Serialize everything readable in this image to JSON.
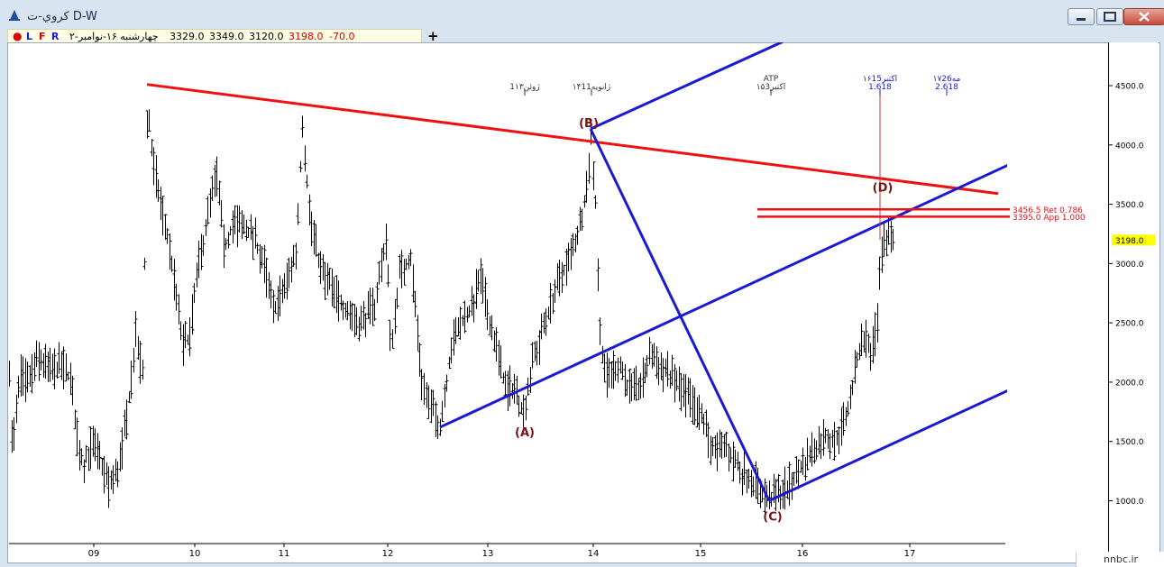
{
  "window": {
    "title": "كروي-ت D-W"
  },
  "toolbar": {
    "buttons": [
      "L",
      "F",
      "R"
    ],
    "date": "چهارشنبه ۱۶-نوامبر-۲",
    "open": "3329.0",
    "high": "3349.0",
    "low": "3120.0",
    "close": "3198.0",
    "change": "-70.0"
  },
  "colors": {
    "red_line": "#ee1111",
    "blue_line": "#1a1ad2",
    "wave_label": "#7a1010",
    "price_badge": "#ffff00"
  },
  "watermark": "nnbc.ir",
  "chart_data": {
    "type": "bar",
    "y_scale": "linear",
    "ylim": [
      700,
      4850
    ],
    "y_ticks": [
      1000,
      1500,
      2000,
      2500,
      3000,
      3500,
      4000,
      4500
    ],
    "y_tick_labels": [
      "1000.0",
      "1500.0",
      "2000.0",
      "2500.0",
      "3000.0",
      "3500.0",
      "4000.0",
      "4500.0"
    ],
    "xlim": [
      0,
      1105
    ],
    "x_ticks": [
      {
        "x": 94,
        "label": "09"
      },
      {
        "x": 206,
        "label": "10"
      },
      {
        "x": 305,
        "label": "11"
      },
      {
        "x": 420,
        "label": "12"
      },
      {
        "x": 531,
        "label": "13"
      },
      {
        "x": 648,
        "label": "14"
      },
      {
        "x": 767,
        "label": "15"
      },
      {
        "x": 880,
        "label": "16"
      },
      {
        "x": 999,
        "label": "17"
      }
    ],
    "last_price_label": "3198.0",
    "last_price": 3198,
    "time_markers": [
      {
        "x": 572,
        "label": "1ژوئن۱۳",
        "color": "#333"
      },
      {
        "x": 646,
        "label": "۱۴ژانویه11",
        "color": "#333"
      },
      {
        "x": 845,
        "label": "۱۵اکتبر3",
        "label_top": "ATP",
        "color": "#333"
      },
      {
        "x": 966,
        "label": "1.618",
        "label_top": "۱۶اکتبر15",
        "color": "#1a1ad2"
      },
      {
        "x": 1040,
        "label": "2.618",
        "label_top": "۱۷مه26",
        "color": "#1a1ad2"
      }
    ],
    "levels": [
      {
        "label": "3456.5 Ret 0.786",
        "value": 3456.5
      },
      {
        "label": "3395.0 App 1.000",
        "value": 3395.0
      }
    ],
    "wave_labels": [
      {
        "label": "(A)",
        "x": 572,
        "y": 1580
      },
      {
        "label": "(B)",
        "x": 643,
        "y": 4190
      },
      {
        "label": "(C)",
        "x": 847,
        "y": 870
      },
      {
        "label": "(D)",
        "x": 969,
        "y": 3645
      }
    ],
    "trendlines": [
      {
        "name": "upper-resistance",
        "color": "#ee1111",
        "x1": 153,
        "y1": 4510,
        "x2": 1097,
        "y2": 3590
      },
      {
        "name": "abc-b-to-c",
        "color": "#1a1ad2",
        "x1": 645,
        "y1": 4135,
        "x2": 843,
        "y2": 1000
      },
      {
        "name": "channel-mid",
        "color": "#1a1ad2",
        "x1": 478,
        "y1": 1620,
        "x2": 1108,
        "y2": 3830
      },
      {
        "name": "channel-top",
        "color": "#1a1ad2",
        "x1": 645,
        "y1": 4135,
        "x2": 858,
        "y2": 4870
      },
      {
        "name": "channel-bottom",
        "color": "#1a1ad2",
        "x1": 843,
        "y1": 1000,
        "x2": 1108,
        "y2": 1930
      },
      {
        "name": "target-vertical",
        "color": "#cc3333",
        "x1": 966,
        "y1": 3200,
        "x2": 966,
        "y2": 4450
      }
    ],
    "anchors": [
      {
        "x": 0,
        "v": 2150
      },
      {
        "x": 3,
        "v": 1400
      },
      {
        "x": 12,
        "v": 2050
      },
      {
        "x": 20,
        "v": 2000
      },
      {
        "x": 32,
        "v": 2200
      },
      {
        "x": 45,
        "v": 2100
      },
      {
        "x": 58,
        "v": 2150
      },
      {
        "x": 68,
        "v": 2000
      },
      {
        "x": 76,
        "v": 1500
      },
      {
        "x": 82,
        "v": 1300
      },
      {
        "x": 92,
        "v": 1480
      },
      {
        "x": 100,
        "v": 1350
      },
      {
        "x": 110,
        "v": 1130
      },
      {
        "x": 118,
        "v": 1200
      },
      {
        "x": 124,
        "v": 1400
      },
      {
        "x": 130,
        "v": 1700
      },
      {
        "x": 140,
        "v": 2400
      },
      {
        "x": 148,
        "v": 2050
      },
      {
        "x": 153,
        "v": 4400
      },
      {
        "x": 158,
        "v": 3900
      },
      {
        "x": 168,
        "v": 3500
      },
      {
        "x": 180,
        "v": 3000
      },
      {
        "x": 192,
        "v": 2300
      },
      {
        "x": 200,
        "v": 2400
      },
      {
        "x": 210,
        "v": 3000
      },
      {
        "x": 220,
        "v": 3400
      },
      {
        "x": 230,
        "v": 3750
      },
      {
        "x": 238,
        "v": 3100
      },
      {
        "x": 248,
        "v": 3350
      },
      {
        "x": 260,
        "v": 3300
      },
      {
        "x": 272,
        "v": 3200
      },
      {
        "x": 282,
        "v": 3000
      },
      {
        "x": 292,
        "v": 2600
      },
      {
        "x": 305,
        "v": 2800
      },
      {
        "x": 318,
        "v": 3100
      },
      {
        "x": 325,
        "v": 4200
      },
      {
        "x": 333,
        "v": 3400
      },
      {
        "x": 345,
        "v": 2950
      },
      {
        "x": 360,
        "v": 2750
      },
      {
        "x": 375,
        "v": 2600
      },
      {
        "x": 390,
        "v": 2500
      },
      {
        "x": 405,
        "v": 2650
      },
      {
        "x": 418,
        "v": 3250
      },
      {
        "x": 423,
        "v": 2250
      },
      {
        "x": 432,
        "v": 2900
      },
      {
        "x": 445,
        "v": 3050
      },
      {
        "x": 458,
        "v": 2000
      },
      {
        "x": 466,
        "v": 1800
      },
      {
        "x": 478,
        "v": 1640
      },
      {
        "x": 490,
        "v": 2300
      },
      {
        "x": 500,
        "v": 2500
      },
      {
        "x": 512,
        "v": 2600
      },
      {
        "x": 522,
        "v": 2900
      },
      {
        "x": 530,
        "v": 2600
      },
      {
        "x": 540,
        "v": 2300
      },
      {
        "x": 550,
        "v": 1950
      },
      {
        "x": 560,
        "v": 1950
      },
      {
        "x": 570,
        "v": 1750
      },
      {
        "x": 580,
        "v": 2150
      },
      {
        "x": 592,
        "v": 2450
      },
      {
        "x": 602,
        "v": 2700
      },
      {
        "x": 612,
        "v": 2900
      },
      {
        "x": 622,
        "v": 3050
      },
      {
        "x": 632,
        "v": 3300
      },
      {
        "x": 640,
        "v": 3650
      },
      {
        "x": 645,
        "v": 4080
      },
      {
        "x": 650,
        "v": 3500
      },
      {
        "x": 655,
        "v": 2400
      },
      {
        "x": 662,
        "v": 2050
      },
      {
        "x": 675,
        "v": 2150
      },
      {
        "x": 690,
        "v": 1900
      },
      {
        "x": 702,
        "v": 2000
      },
      {
        "x": 712,
        "v": 2250
      },
      {
        "x": 725,
        "v": 2100
      },
      {
        "x": 740,
        "v": 2000
      },
      {
        "x": 755,
        "v": 1850
      },
      {
        "x": 770,
        "v": 1650
      },
      {
        "x": 782,
        "v": 1400
      },
      {
        "x": 795,
        "v": 1450
      },
      {
        "x": 810,
        "v": 1250
      },
      {
        "x": 822,
        "v": 1200
      },
      {
        "x": 832,
        "v": 1100
      },
      {
        "x": 843,
        "v": 1000
      },
      {
        "x": 855,
        "v": 1080
      },
      {
        "x": 868,
        "v": 1150
      },
      {
        "x": 880,
        "v": 1300
      },
      {
        "x": 892,
        "v": 1450
      },
      {
        "x": 905,
        "v": 1550
      },
      {
        "x": 915,
        "v": 1500
      },
      {
        "x": 922,
        "v": 1600
      },
      {
        "x": 932,
        "v": 1800
      },
      {
        "x": 940,
        "v": 2200
      },
      {
        "x": 948,
        "v": 2400
      },
      {
        "x": 955,
        "v": 2250
      },
      {
        "x": 962,
        "v": 2450
      },
      {
        "x": 966,
        "v": 3000
      },
      {
        "x": 970,
        "v": 3150
      },
      {
        "x": 976,
        "v": 3300
      },
      {
        "x": 980,
        "v": 3198
      }
    ]
  }
}
